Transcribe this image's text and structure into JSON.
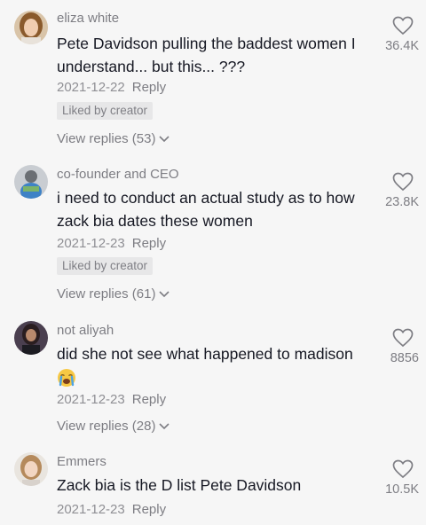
{
  "comments": [
    {
      "username": "eliza white",
      "text": "Pete Davidson pulling the baddest women I understand... but this... ???",
      "date": "2021-12-22",
      "reply_label": "Reply",
      "liked_by_creator": "Liked by creator",
      "view_replies": "View replies (53)",
      "like_count": "36.4K",
      "avatar_icon": "avatar-photo-woman-blonde"
    },
    {
      "username": "co-founder and CEO",
      "text": "i need to conduct an actual study as to how zack bia dates these women",
      "date": "2021-12-23",
      "reply_label": "Reply",
      "liked_by_creator": "Liked by creator",
      "view_replies": "View replies (61)",
      "like_count": "23.8K",
      "avatar_icon": "avatar-photo-figure-blue"
    },
    {
      "username": "not aliyah",
      "text": "did she not see what happened to madison",
      "emoji": "loudly-crying-face",
      "date": "2021-12-23",
      "reply_label": "Reply",
      "view_replies": "View replies (28)",
      "like_count": "8856",
      "avatar_icon": "avatar-photo-woman-dark"
    },
    {
      "username": "Emmers",
      "text": "Zack bia is the D list Pete Davidson",
      "date": "2021-12-23",
      "reply_label": "Reply",
      "like_count": "10.5K",
      "avatar_icon": "avatar-photo-woman-light"
    }
  ],
  "colors": {
    "background": "#f6f6f6",
    "text_primary": "#161823",
    "text_secondary": "#7d7d83",
    "badge_bg": "#e7e7e8"
  }
}
